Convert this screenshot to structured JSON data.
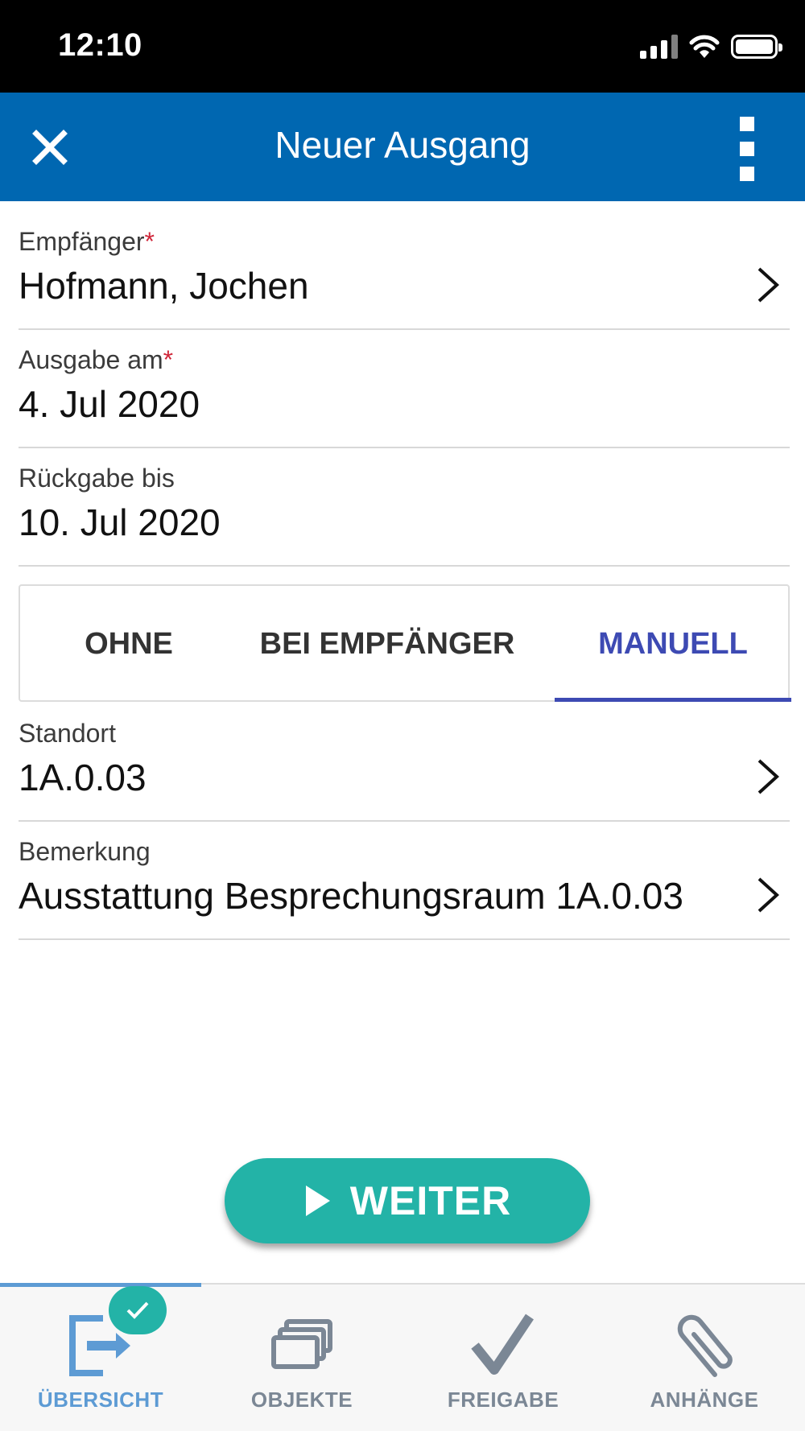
{
  "status_bar": {
    "time": "12:10"
  },
  "app_bar": {
    "title": "Neuer Ausgang",
    "close_icon": "close-icon",
    "menu_icon": "more-vertical-icon",
    "background_color": "#0067b1"
  },
  "form": {
    "recipient": {
      "label": "Empfänger",
      "required_mark": "*",
      "value": "Hofmann, Jochen"
    },
    "issue_date": {
      "label": "Ausgabe am",
      "required_mark": "*",
      "value": "4. Jul 2020"
    },
    "return_date": {
      "label": "Rückgabe bis",
      "value": "10. Jul 2020"
    },
    "location": {
      "label": "Standort",
      "value": "1A.0.03"
    },
    "remark": {
      "label": "Bemerkung",
      "value": "Ausstattung Besprechungsraum 1A.0.03"
    }
  },
  "tabs": {
    "items": [
      {
        "label": "OHNE",
        "active": false
      },
      {
        "label": "BEI EMPFÄNGER",
        "active": false
      },
      {
        "label": "MANUELL",
        "active": true
      }
    ],
    "active_color": "#3d4ab3"
  },
  "weiter_button": {
    "label": "WEITER",
    "icon": "play-icon",
    "color": "#23b3a7"
  },
  "bottom_nav": {
    "items": [
      {
        "label": "ÜBERSICHT",
        "icon": "exit-icon",
        "active": true,
        "badge_icon": "check-icon"
      },
      {
        "label": "OBJEKTE",
        "icon": "stack-icon",
        "active": false
      },
      {
        "label": "FREIGABE",
        "icon": "check-icon",
        "active": false
      },
      {
        "label": "ANHÄNGE",
        "icon": "paperclip-icon",
        "active": false
      }
    ],
    "active_color": "#5d9bd4",
    "inactive_color": "#7b8795"
  }
}
